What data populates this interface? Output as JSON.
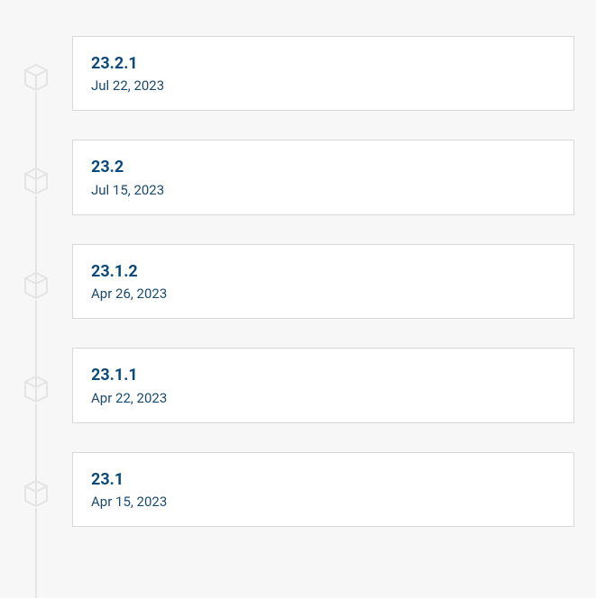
{
  "releases": [
    {
      "version": "23.2.1",
      "date": "Jul 22, 2023"
    },
    {
      "version": "23.2",
      "date": "Jul 15, 2023"
    },
    {
      "version": "23.1.2",
      "date": "Apr 26, 2023"
    },
    {
      "version": "23.1.1",
      "date": "Apr 22, 2023"
    },
    {
      "version": "23.1",
      "date": "Apr 15, 2023"
    }
  ]
}
